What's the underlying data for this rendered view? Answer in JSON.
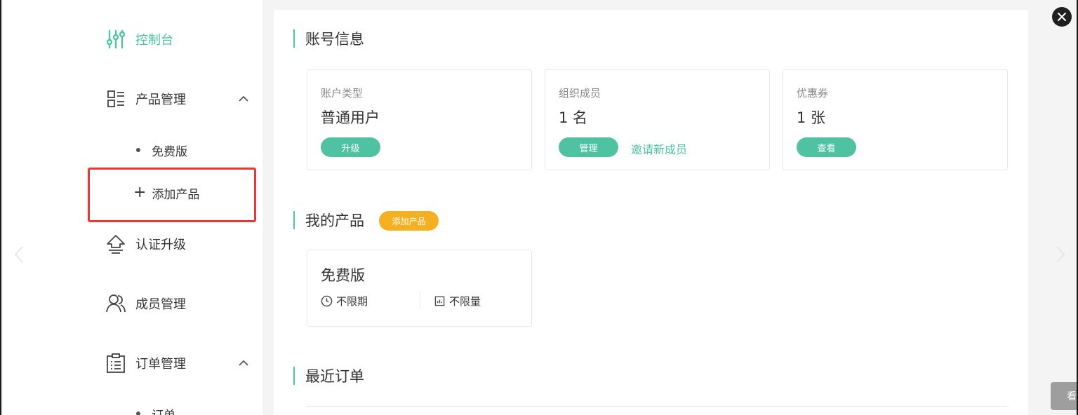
{
  "sidebar": {
    "dashboard": "控制台",
    "product_mgmt": "产品管理",
    "free_edition": "免费版",
    "add_product": "添加产品",
    "cert_upgrade": "认证升级",
    "member_mgmt": "成员管理",
    "order_mgmt": "订单管理",
    "orders": "订单"
  },
  "account": {
    "title": "账号信息",
    "cards": [
      {
        "label": "账户类型",
        "value": "普通用户",
        "button": "升级"
      },
      {
        "label": "组织成员",
        "value": "1 名",
        "button": "管理",
        "link": "邀请新成员"
      },
      {
        "label": "优惠券",
        "value": "1 张",
        "button": "查看"
      }
    ]
  },
  "products": {
    "title": "我的产品",
    "add_badge": "添加产品",
    "items": [
      {
        "name": "免费版",
        "period": "不限期",
        "quota": "不限量"
      }
    ]
  },
  "orders": {
    "title": "最近订单"
  },
  "overlay": {
    "float_label": "看"
  },
  "colors": {
    "accent": "#4fc3a1",
    "badge": "#f5b022",
    "highlight": "#e53935"
  }
}
